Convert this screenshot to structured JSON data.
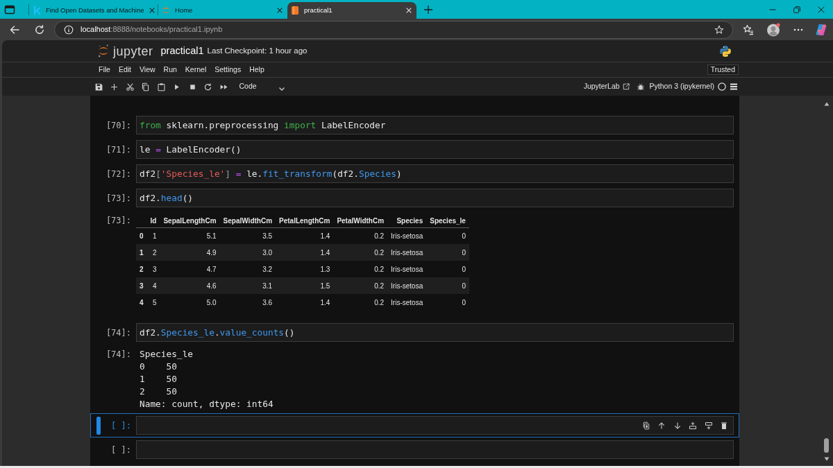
{
  "browser": {
    "tabs": [
      {
        "title": "Find Open Datasets and Machine",
        "selected": false
      },
      {
        "title": "Home",
        "selected": false
      },
      {
        "title": "practical1",
        "selected": true
      }
    ],
    "address": {
      "host": "localhost",
      "path": ":8888/notebooks/practical1.ipynb"
    }
  },
  "header": {
    "logo_text": "jupyter",
    "notebook_name": "practical1",
    "checkpoint": "Last Checkpoint: 1 hour ago"
  },
  "menu": [
    "File",
    "Edit",
    "View",
    "Run",
    "Kernel",
    "Settings",
    "Help"
  ],
  "trust_status": "Trusted",
  "toolbar": {
    "cell_type": "Code",
    "lab_link": "JupyterLab",
    "kernel_name": "Python 3 (ipykernel)"
  },
  "cells": [
    {
      "prompt": "[70]:",
      "selected": false,
      "code": [
        {
          "kind": "keyword",
          "text": "from"
        },
        {
          "kind": "plain",
          "text": " sklearn.preprocessing "
        },
        {
          "kind": "keyword",
          "text": "import"
        },
        {
          "kind": "plain",
          "text": " LabelEncoder"
        }
      ]
    },
    {
      "prompt": "[71]:",
      "selected": false,
      "code": [
        {
          "kind": "plain",
          "text": "le "
        },
        {
          "kind": "operator",
          "text": "="
        },
        {
          "kind": "plain",
          "text": " LabelEncoder()"
        }
      ]
    },
    {
      "prompt": "[72]:",
      "selected": false,
      "code": [
        {
          "kind": "plain",
          "text": "df2"
        },
        {
          "kind": "bracket",
          "text": "["
        },
        {
          "kind": "string",
          "text": "'Species_le'"
        },
        {
          "kind": "bracket",
          "text": "] "
        },
        {
          "kind": "operator",
          "text": "="
        },
        {
          "kind": "plain",
          "text": " le."
        },
        {
          "kind": "property",
          "text": "fit_transform"
        },
        {
          "kind": "plain",
          "text": "(df2."
        },
        {
          "kind": "property",
          "text": "Species"
        },
        {
          "kind": "plain",
          "text": ")"
        }
      ]
    },
    {
      "prompt": "[73]:",
      "selected": false,
      "code": [
        {
          "kind": "plain",
          "text": "df2."
        },
        {
          "kind": "property",
          "text": "head"
        },
        {
          "kind": "plain",
          "text": "()"
        }
      ],
      "output": {
        "kind": "table",
        "prompt": "[73]:",
        "columns": [
          "Id",
          "SepalLengthCm",
          "SepalWidthCm",
          "PetalLengthCm",
          "PetalWidthCm",
          "Species",
          "Species_le"
        ],
        "rows": [
          {
            "index": "0",
            "values": [
              "1",
              "5.1",
              "3.5",
              "1.4",
              "0.2",
              "Iris-setosa",
              "0"
            ]
          },
          {
            "index": "1",
            "values": [
              "2",
              "4.9",
              "3.0",
              "1.4",
              "0.2",
              "Iris-setosa",
              "0"
            ]
          },
          {
            "index": "2",
            "values": [
              "3",
              "4.7",
              "3.2",
              "1.3",
              "0.2",
              "Iris-setosa",
              "0"
            ]
          },
          {
            "index": "3",
            "values": [
              "4",
              "4.6",
              "3.1",
              "1.5",
              "0.2",
              "Iris-setosa",
              "0"
            ]
          },
          {
            "index": "4",
            "values": [
              "5",
              "5.0",
              "3.6",
              "1.4",
              "0.2",
              "Iris-setosa",
              "0"
            ]
          }
        ]
      }
    },
    {
      "prompt": "[74]:",
      "selected": false,
      "code": [
        {
          "kind": "plain",
          "text": "df2."
        },
        {
          "kind": "property",
          "text": "Species_le"
        },
        {
          "kind": "plain",
          "text": "."
        },
        {
          "kind": "property",
          "text": "value_counts"
        },
        {
          "kind": "plain",
          "text": "()"
        }
      ],
      "output": {
        "kind": "text",
        "prompt": "[74]:",
        "lines": [
          "Species_le",
          "0    50",
          "1    50",
          "2    50",
          "Name: count, dtype: int64"
        ]
      }
    },
    {
      "prompt": "[ ]:",
      "selected": true
    },
    {
      "prompt": "[ ]:",
      "selected": false
    }
  ]
}
